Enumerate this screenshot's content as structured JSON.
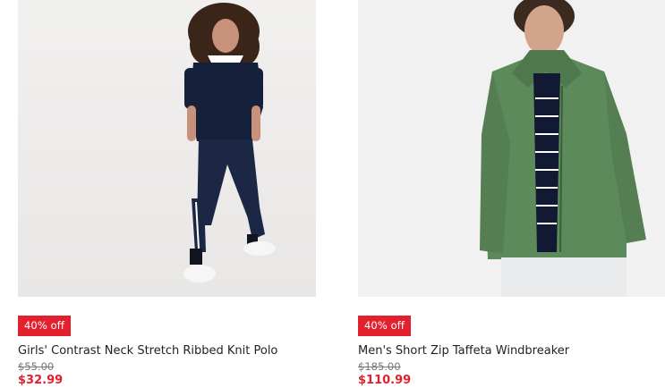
{
  "products": [
    {
      "badge": "40% off",
      "name": "Girls' Contrast Neck Stretch Ribbed Knit Polo",
      "original_price": "$55.00",
      "sale_price": "$32.99",
      "image_subject": "girl-navy-polo-photo"
    },
    {
      "badge": "40% off",
      "name": "Men's Short Zip Taffeta Windbreaker",
      "original_price": "$185.00",
      "sale_price": "$110.99",
      "image_subject": "man-green-windbreaker-photo"
    }
  ],
  "colors": {
    "badge_bg": "#e3202e",
    "sale_price": "#e3202e",
    "original_price": "#777777"
  }
}
